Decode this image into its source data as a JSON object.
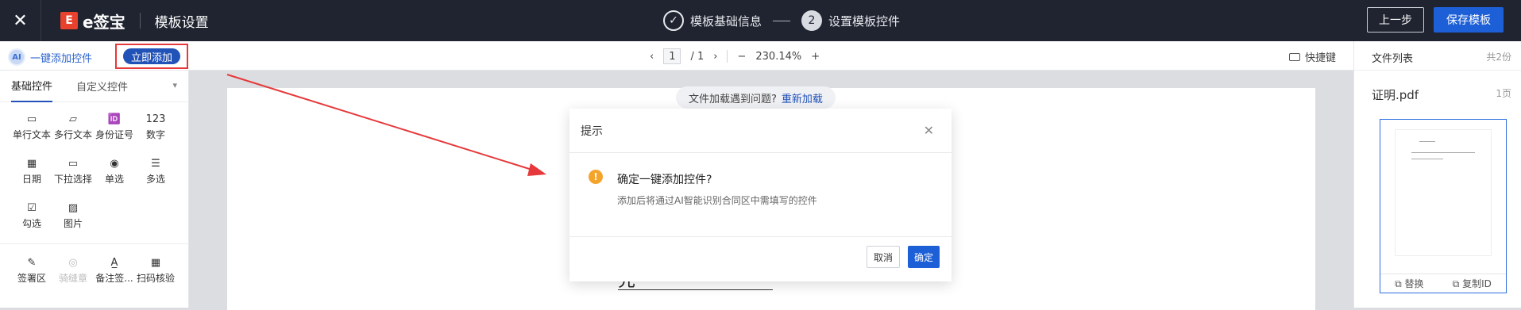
{
  "topbar": {
    "close_icon": "close-icon",
    "brand_logo_letter": "E",
    "brand_name": "e签宝",
    "page_title": "模板设置",
    "steps": [
      {
        "label": "模板基础信息",
        "state": "done",
        "marker": "✓"
      },
      {
        "label": "设置模板控件",
        "state": "active",
        "marker": "2"
      }
    ],
    "prev_button": "上一步",
    "save_button": "保存模板"
  },
  "toolbar": {
    "ai_label": "一键添加控件",
    "add_now_button": "立即添加",
    "page_current": "1",
    "page_total": "/ 1",
    "zoom_minus": "−",
    "zoom_level": "230.14%",
    "zoom_plus": "+",
    "shortcut_label": "快捷键"
  },
  "left_panel": {
    "tab_basic": "基础控件",
    "tab_custom": "自定义控件",
    "controls": [
      {
        "label": "单行文本",
        "icon": "▭"
      },
      {
        "label": "多行文本",
        "icon": "▱"
      },
      {
        "label": "身份证号",
        "icon": "🆔"
      },
      {
        "label": "数字",
        "icon": "123"
      },
      {
        "label": "日期",
        "icon": "▦"
      },
      {
        "label": "下拉选择",
        "icon": "▭"
      },
      {
        "label": "单选",
        "icon": "◉"
      },
      {
        "label": "多选",
        "icon": "☰"
      },
      {
        "label": "勾选",
        "icon": "☑"
      },
      {
        "label": "图片",
        "icon": "▨"
      }
    ],
    "sign_controls": [
      {
        "label": "签署区",
        "icon": "✎",
        "disabled": false
      },
      {
        "label": "骑缝章",
        "icon": "◎",
        "disabled": true
      },
      {
        "label": "备注签...",
        "icon": "A̲",
        "disabled": false
      },
      {
        "label": "扫码核验",
        "icon": "▦",
        "disabled": false
      }
    ]
  },
  "canvas": {
    "reload_text": "文件加载遇到问题?",
    "reload_link": "重新加载",
    "doc_fragment": "先"
  },
  "right_panel": {
    "title": "文件列表",
    "count": "共2份",
    "file_name": "证明.pdf",
    "file_pages": "1页",
    "replace": "替换",
    "copy_id": "复制ID"
  },
  "modal": {
    "header": "提示",
    "question": "确定一键添加控件?",
    "description": "添加后将通过AI智能识别合同区中需填写的控件",
    "cancel": "取消",
    "confirm": "确定"
  },
  "colors": {
    "topbar_bg": "#1f2430",
    "primary": "#1d5fd7",
    "highlight_red": "#e5393b",
    "warning": "#f4a42a"
  }
}
